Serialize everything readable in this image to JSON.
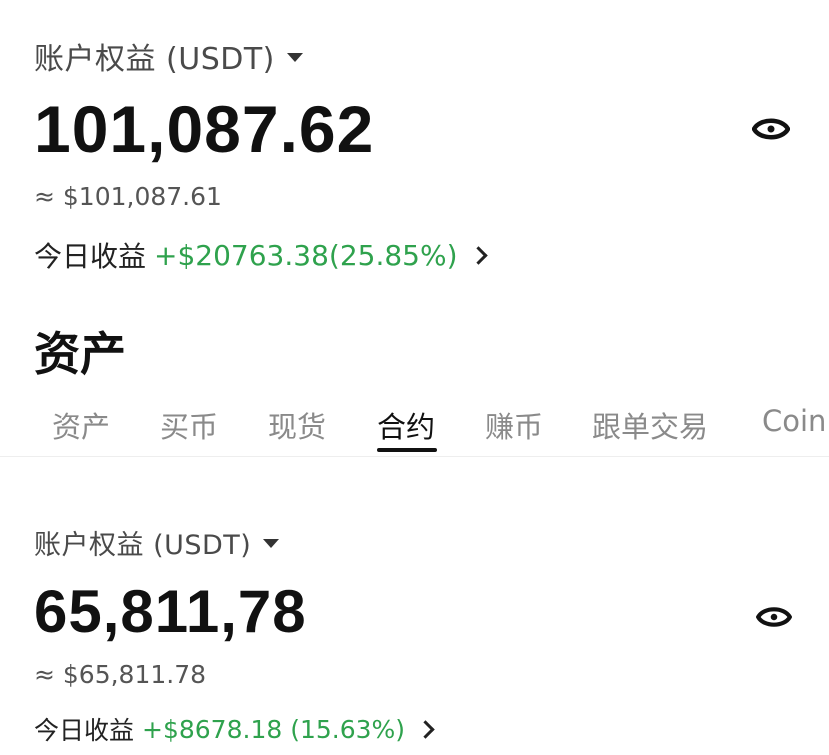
{
  "top_account": {
    "equity_label": "账户权益 (USDT)",
    "amount": "101,087.62",
    "approx": "≈ $101,087.61",
    "pnl_label": "今日收益",
    "pnl_value": "+$20763.38(25.85%)"
  },
  "assets_title": "资产",
  "tabs": [
    {
      "label": "资产"
    },
    {
      "label": "买币"
    },
    {
      "label": "现货"
    },
    {
      "label": "合约"
    },
    {
      "label": "赚币"
    },
    {
      "label": "跟单交易"
    },
    {
      "label": "Coin"
    }
  ],
  "bottom_account": {
    "equity_label": "账户权益 (USDT)",
    "amount": "65,811,78",
    "approx": "≈ $65,811.78",
    "pnl_label": "今日收益",
    "pnl_value": "+$8678.18 (15.63%)"
  },
  "colors": {
    "profit": "#2fa24d",
    "text": "#111111",
    "muted": "#8a8a8a"
  },
  "icons": {
    "visibility": "eye-icon",
    "dropdown": "caret-down-icon",
    "navigate": "chevron-right-icon"
  }
}
